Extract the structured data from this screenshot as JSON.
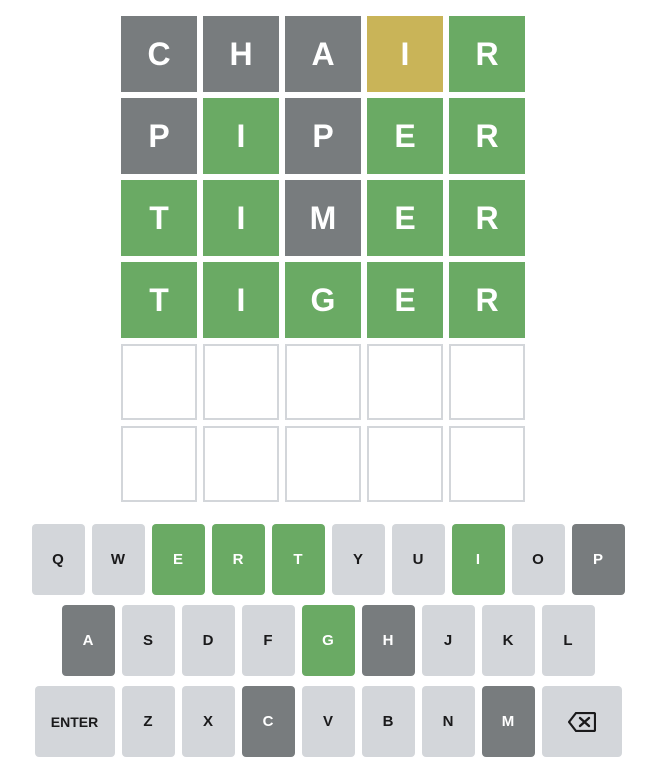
{
  "board": {
    "rows": [
      {
        "tiles": [
          {
            "letter": "C",
            "state": "absent"
          },
          {
            "letter": "H",
            "state": "absent"
          },
          {
            "letter": "A",
            "state": "absent"
          },
          {
            "letter": "I",
            "state": "present"
          },
          {
            "letter": "R",
            "state": "correct"
          }
        ]
      },
      {
        "tiles": [
          {
            "letter": "P",
            "state": "absent"
          },
          {
            "letter": "I",
            "state": "correct"
          },
          {
            "letter": "P",
            "state": "absent"
          },
          {
            "letter": "E",
            "state": "correct"
          },
          {
            "letter": "R",
            "state": "correct"
          }
        ]
      },
      {
        "tiles": [
          {
            "letter": "T",
            "state": "correct"
          },
          {
            "letter": "I",
            "state": "correct"
          },
          {
            "letter": "M",
            "state": "absent"
          },
          {
            "letter": "E",
            "state": "correct"
          },
          {
            "letter": "R",
            "state": "correct"
          }
        ]
      },
      {
        "tiles": [
          {
            "letter": "T",
            "state": "correct"
          },
          {
            "letter": "I",
            "state": "correct"
          },
          {
            "letter": "G",
            "state": "correct"
          },
          {
            "letter": "E",
            "state": "correct"
          },
          {
            "letter": "R",
            "state": "correct"
          }
        ]
      },
      {
        "tiles": [
          {
            "letter": "",
            "state": "empty"
          },
          {
            "letter": "",
            "state": "empty"
          },
          {
            "letter": "",
            "state": "empty"
          },
          {
            "letter": "",
            "state": "empty"
          },
          {
            "letter": "",
            "state": "empty"
          }
        ]
      },
      {
        "tiles": [
          {
            "letter": "",
            "state": "empty"
          },
          {
            "letter": "",
            "state": "empty"
          },
          {
            "letter": "",
            "state": "empty"
          },
          {
            "letter": "",
            "state": "empty"
          },
          {
            "letter": "",
            "state": "empty"
          }
        ]
      }
    ]
  },
  "keyboard": {
    "rows": [
      [
        {
          "label": "Q",
          "state": "unused"
        },
        {
          "label": "W",
          "state": "unused"
        },
        {
          "label": "E",
          "state": "correct"
        },
        {
          "label": "R",
          "state": "correct"
        },
        {
          "label": "T",
          "state": "correct"
        },
        {
          "label": "Y",
          "state": "unused"
        },
        {
          "label": "U",
          "state": "unused"
        },
        {
          "label": "I",
          "state": "correct"
        },
        {
          "label": "O",
          "state": "unused"
        },
        {
          "label": "P",
          "state": "absent"
        }
      ],
      [
        {
          "label": "A",
          "state": "absent"
        },
        {
          "label": "S",
          "state": "unused"
        },
        {
          "label": "D",
          "state": "unused"
        },
        {
          "label": "F",
          "state": "unused"
        },
        {
          "label": "G",
          "state": "correct"
        },
        {
          "label": "H",
          "state": "absent"
        },
        {
          "label": "J",
          "state": "unused"
        },
        {
          "label": "K",
          "state": "unused"
        },
        {
          "label": "L",
          "state": "unused"
        }
      ],
      [
        {
          "label": "ENTER",
          "state": "unused",
          "wide": true,
          "name": "enter-key"
        },
        {
          "label": "Z",
          "state": "unused"
        },
        {
          "label": "X",
          "state": "unused"
        },
        {
          "label": "C",
          "state": "absent"
        },
        {
          "label": "V",
          "state": "unused"
        },
        {
          "label": "B",
          "state": "unused"
        },
        {
          "label": "N",
          "state": "unused"
        },
        {
          "label": "M",
          "state": "absent"
        },
        {
          "label": "",
          "state": "unused",
          "wide": true,
          "icon": "backspace-icon",
          "name": "backspace-key"
        }
      ]
    ]
  },
  "colors": {
    "absent": "#787c7e",
    "present": "#c9b458",
    "correct": "#6aaa64",
    "unused_key": "#d3d6da",
    "empty_border": "#d3d6da"
  }
}
